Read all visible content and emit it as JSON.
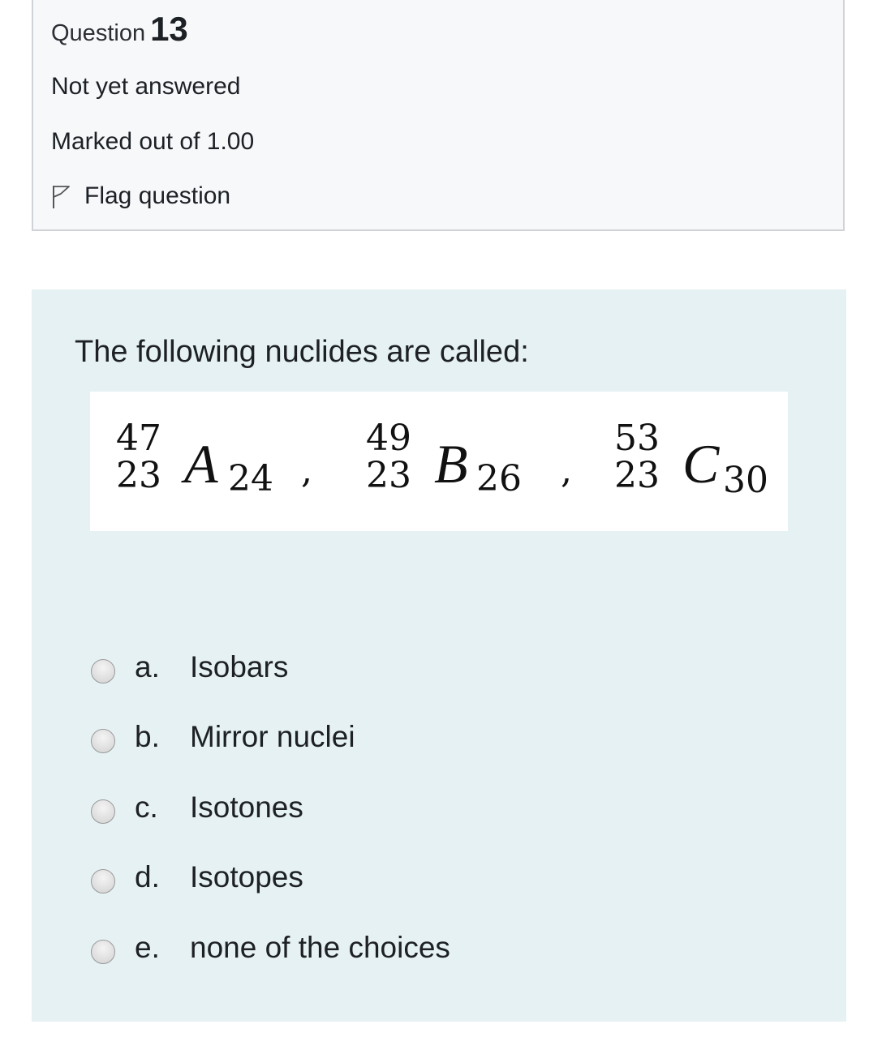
{
  "info": {
    "question_word": "Question",
    "question_number": "13",
    "state": "Not yet answered",
    "grade": "Marked out of 1.00",
    "flag_label": "Flag question",
    "flag_icon": "flag-outline-icon"
  },
  "question": {
    "text": "The following nuclides are called:",
    "nuclides": [
      {
        "mass": "47",
        "atomic": "23",
        "symbol": "A",
        "neutrons": "24"
      },
      {
        "mass": "49",
        "atomic": "23",
        "symbol": "B",
        "neutrons": "26"
      },
      {
        "mass": "53",
        "atomic": "23",
        "symbol": "C",
        "neutrons": "30"
      }
    ],
    "separator": ","
  },
  "options": [
    {
      "letter": "a.",
      "text": "Isobars"
    },
    {
      "letter": "b.",
      "text": "Mirror nuclei"
    },
    {
      "letter": "c.",
      "text": "Isotones"
    },
    {
      "letter": "d.",
      "text": "Isotopes"
    },
    {
      "letter": "e.",
      "text": "none of the choices"
    }
  ]
}
